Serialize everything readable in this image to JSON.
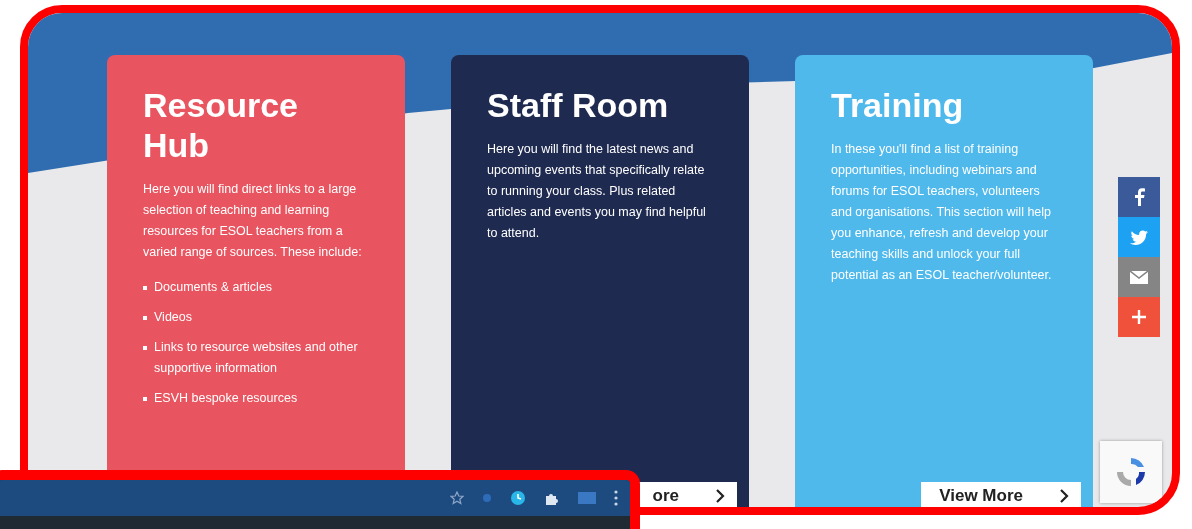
{
  "cards": [
    {
      "title": "Resource Hub",
      "color": "#e8545f",
      "body": "Here you will find direct links to a large selection of teaching and learning resources for ESOL teachers from a varied range of sources. These include:",
      "bullets": [
        "Documents & articles",
        "Videos",
        "Links to resource websites and other supportive information",
        "ESVH bespoke resources"
      ]
    },
    {
      "title": "Staff Room",
      "color": "#1f2a50",
      "body": "Here you will find the latest news and upcoming events that specifically relate to running your class. Plus related articles and events you may find helpful to attend.",
      "button": "ore"
    },
    {
      "title": "Training",
      "color": "#4fb9ec",
      "body": "In these you'll find a list of training opportunities, including webinars and forums for ESOL teachers, volunteers and organisations. This section will help you enhance, refresh and develop your teaching skills and unlock your full potential as an ESOL teacher/volunteer.",
      "button": "View More"
    }
  ],
  "share": [
    {
      "kind": "facebook",
      "color": "#3b5a9a"
    },
    {
      "kind": "twitter",
      "color": "#1da1f2"
    },
    {
      "kind": "email",
      "color": "#858585"
    },
    {
      "kind": "more",
      "color": "#f0513b"
    }
  ]
}
